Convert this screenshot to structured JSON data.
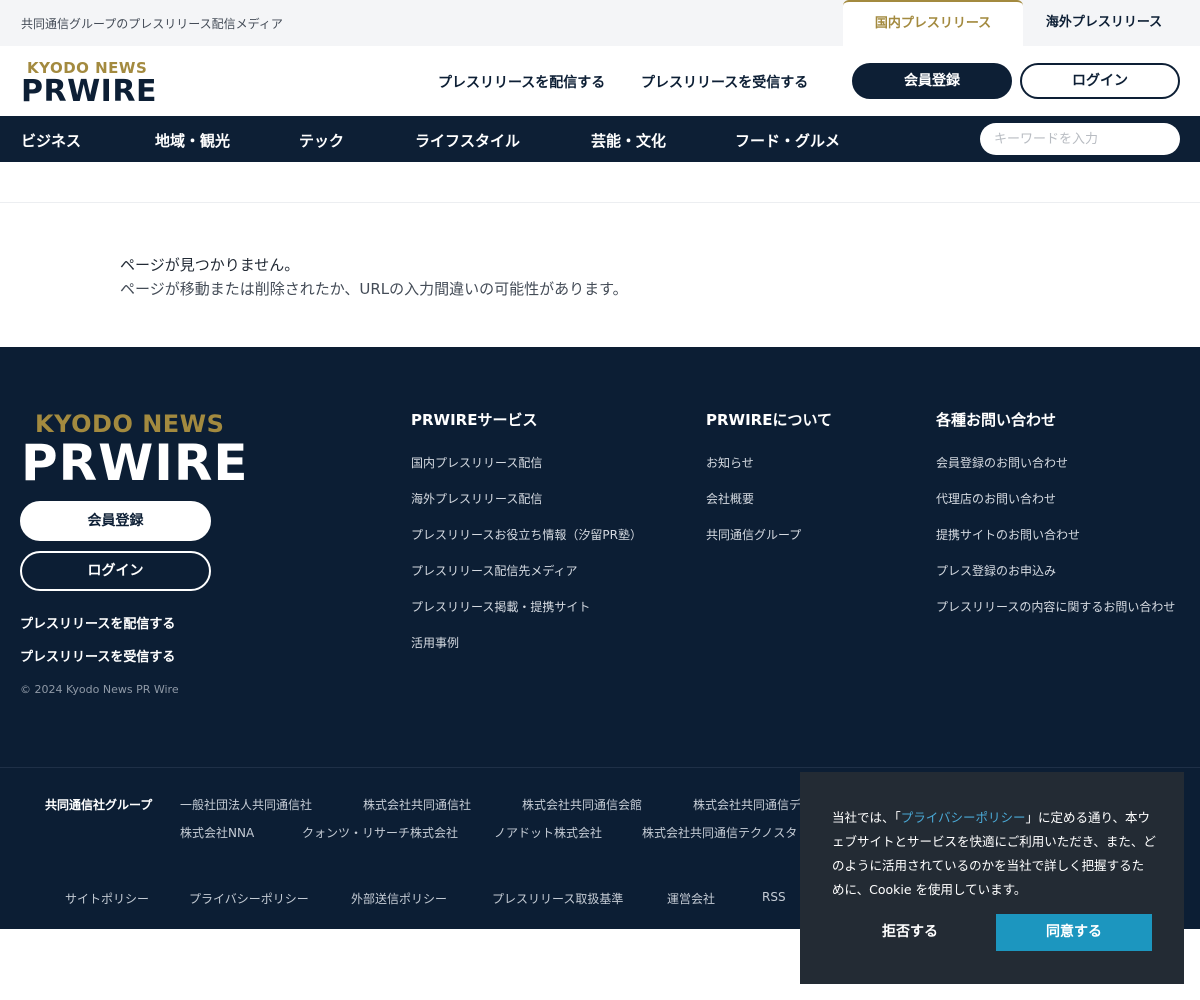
{
  "topbar": {
    "tagline": "共同通信グループのプレスリリース配信メディア",
    "tab_domestic": "国内プレスリリース",
    "tab_overseas": "海外プレスリリース"
  },
  "header": {
    "logo_top": "KYODO NEWS",
    "logo_main": "PRWIRE",
    "link_send": "プレスリリースを配信する",
    "link_receive": "プレスリリースを受信する",
    "register_label": "会員登録",
    "login_label": "ログイン"
  },
  "nav": {
    "categories": [
      "ビジネス",
      "地域・観光",
      "テック",
      "ライフスタイル",
      "芸能・文化",
      "フード・グルメ"
    ],
    "search_placeholder": "キーワードを入力"
  },
  "main": {
    "line1": "ページが見つかりません。",
    "line2": "ページが移動または削除されたか、URLの入力間違いの可能性があります。"
  },
  "footer": {
    "logo_top": "KYODO NEWS",
    "logo_main": "PRWIRE",
    "register_label": "会員登録",
    "login_label": "ログイン",
    "link_send": "プレスリリースを配信する",
    "link_receive": "プレスリリースを受信する",
    "copyright": "© 2024 Kyodo News PR Wire",
    "columns": [
      {
        "title": "PRWIREサービス",
        "links": [
          "国内プレスリリース配信",
          "海外プレスリリース配信",
          "プレスリリースお役立ち情報（汐留PR塾）",
          "プレスリリース配信先メディア",
          "プレスリリース掲載・提携サイト",
          "活用事例"
        ]
      },
      {
        "title": "PRWIREについて",
        "links": [
          "お知らせ",
          "会社概要",
          "共同通信グループ"
        ]
      },
      {
        "title": "各種お問い合わせ",
        "links": [
          "会員登録のお問い合わせ",
          "代理店のお問い合わせ",
          "提携サイトのお問い合わせ",
          "プレス登録のお申込み",
          "プレスリリースの内容に関するお問い合わせ"
        ]
      }
    ]
  },
  "group": {
    "label": "共同通信社グループ",
    "row1": [
      "一般社団法人共同通信社",
      "株式会社共同通信社",
      "株式会社共同通信会館",
      "株式会社共同通信デ"
    ],
    "row2": [
      "株式会社NNA",
      "クォンツ・リサーチ株式会社",
      "ノアドット株式会社",
      "株式会社共同通信テクノスタ"
    ],
    "bottom_links": [
      "サイトポリシー",
      "プライバシーポリシー",
      "外部送信ポリシー",
      "プレスリリース取扱基準",
      "運営会社",
      "RSS"
    ]
  },
  "cookie": {
    "text_before": "当社では、「",
    "link_text": "プライバシーポリシー",
    "text_after": "」に定める通り、本ウェブサイトとサービスを快適にご利用いただき、また、どのように活用されているのかを当社で詳しく把握するために、Cookie を使用しています。",
    "reject_label": "拒否する",
    "accept_label": "同意する"
  },
  "colors": {
    "navy": "#0d1f35",
    "gold": "#a38a3f",
    "cookie_bg": "#232b34",
    "accept_blue": "#1c96bf"
  }
}
